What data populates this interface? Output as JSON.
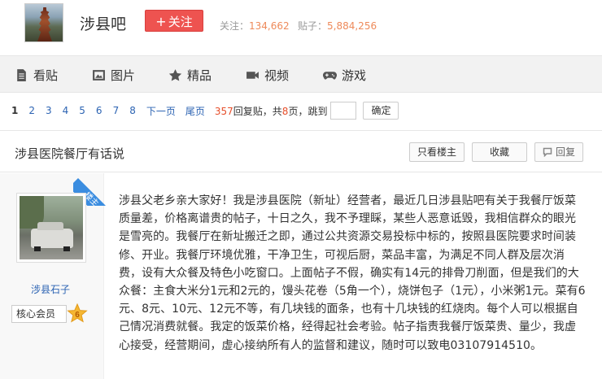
{
  "forum": {
    "name": "涉县吧",
    "follow_label": "关注",
    "follow_plus": "+",
    "stats": {
      "followers_label": "关注：",
      "followers": "134,662",
      "posts_label": "贴子：",
      "posts": "5,884,256"
    }
  },
  "nav": [
    {
      "label": "看贴",
      "icon": "document-icon"
    },
    {
      "label": "图片",
      "icon": "image-icon"
    },
    {
      "label": "精品",
      "icon": "star-icon"
    },
    {
      "label": "视频",
      "icon": "video-camera-icon"
    },
    {
      "label": "游戏",
      "icon": "gamepad-icon"
    }
  ],
  "pager": {
    "current": "1",
    "pages": [
      "2",
      "3",
      "4",
      "5",
      "6",
      "7",
      "8"
    ],
    "next": "下一页",
    "last": "尾页",
    "reply_count": "357",
    "reply_text": "回复贴，共",
    "page_count": "8",
    "page_text": "页，跳到",
    "jump_value": "",
    "go_label": "确定"
  },
  "thread": {
    "title": "涉县医院餐厅有话说",
    "only_op_label": "只看楼主",
    "favorite_label": "收藏",
    "reply_label": "回复"
  },
  "post": {
    "op_badge": "楼主",
    "author": "涉县石子",
    "member_label": "核心会员",
    "level": "6",
    "content": "涉县父老乡亲大家好！我是涉县医院（新址）经营者，最近几日涉县贴吧有关于我餐厅饭菜质量差，价格离谱贵的帖子，十日之久，我不予理睬，某些人恶意诋毁，我相信群众的眼光是雪亮的。我餐厅在新址搬迁之即，通过公共资源交易投标中标的，按照县医院要求时间装修、开业。我餐厅环境优雅，干净卫生，可视后厨，菜品丰富，为满足不同人群及层次消费，设有大众餐及特色小吃窗口。上面帖子不假，确实有14元的排骨刀削面，但是我们的大众餐：主食大米分1元和2元的，馒头花卷（5角一个），烧饼包子（1元），小米粥1元。菜有6元、8元、10元、12元不等，有几块钱的面条，也有十几块钱的红烧肉。每个人可以根据自己情况消费就餐。我定的饭菜价格，经得起社会考验。帖子指责我餐厅饭菜贵、量少，我虚心接受，经营期间，虚心接纳所有人的监督和建议，随时可以致电03107914510。"
  },
  "colors": {
    "accent_red": "#ee5350",
    "link_blue": "#2d64b3",
    "badge_blue": "#3b8de0",
    "count_red": "#e64e2a"
  }
}
